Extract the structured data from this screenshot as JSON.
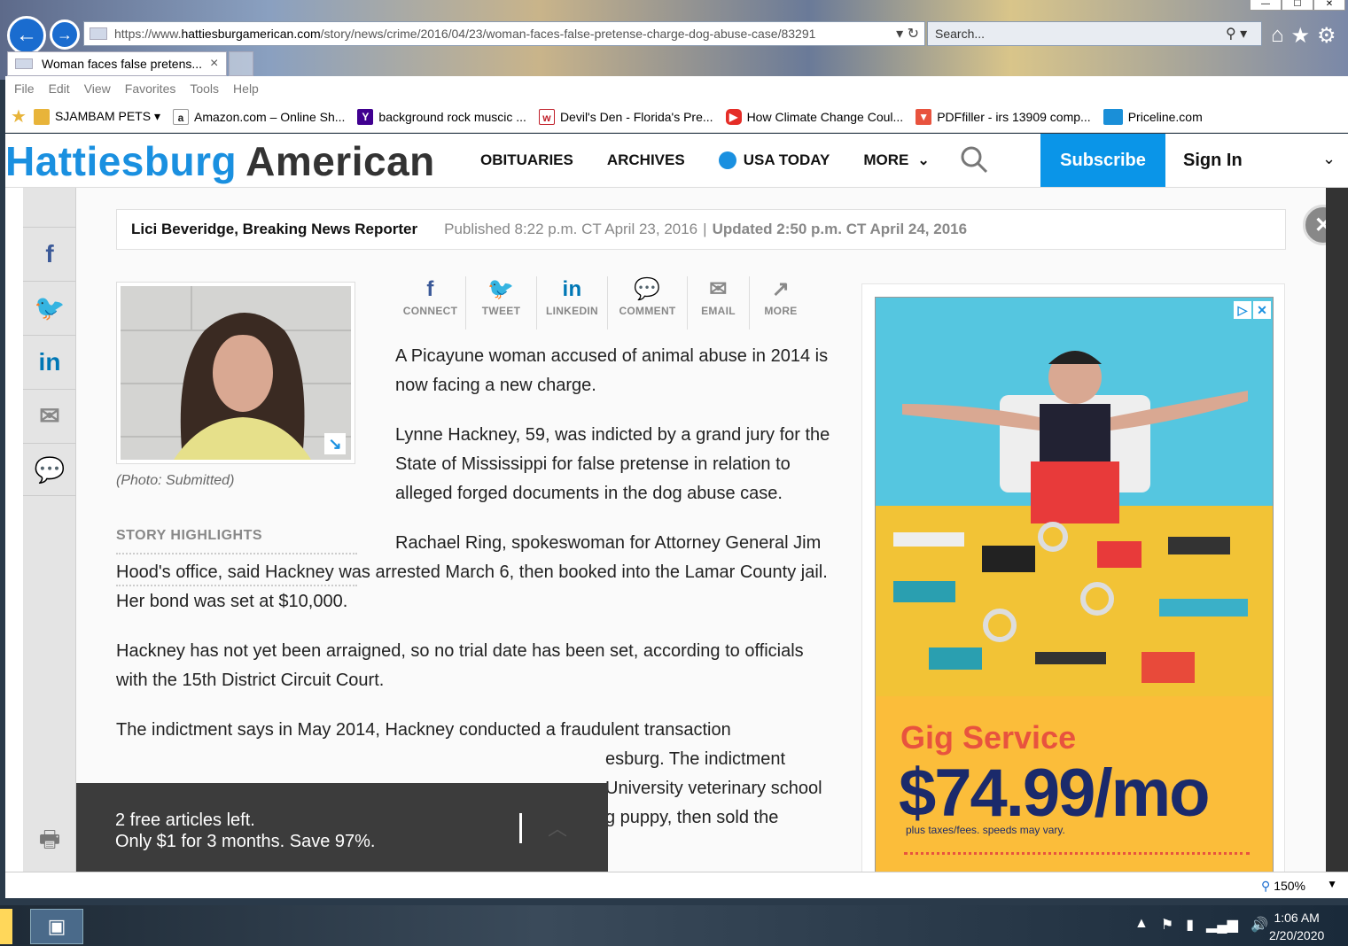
{
  "browser": {
    "url": "https://www.hattiesburgamerican.com/story/news/crime/2016/04/23/woman-faces-false-pretense-charge-dog-abuse-case/83291",
    "url_prefix": "https://www.",
    "url_domain": "hattiesburgamerican.com",
    "url_path": "/story/news/crime/2016/04/23/woman-faces-false-pretense-charge-dog-abuse-case/83291",
    "search_placeholder": "Search...",
    "tab_title": "Woman faces false pretens...",
    "tab_close": "×",
    "menu": [
      "File",
      "Edit",
      "View",
      "Favorites",
      "Tools",
      "Help"
    ],
    "favorites": [
      {
        "label": "SJAMBAM PETS ▾",
        "icon": "folder-icon",
        "color": "#e8b43a"
      },
      {
        "label": "Amazon.com – Online Sh...",
        "icon": "amazon-icon",
        "color": "#222222"
      },
      {
        "label": "background rock muscic ...",
        "icon": "yahoo-icon",
        "color": "#400090"
      },
      {
        "label": "Devil's Den - Florida's Pre...",
        "icon": "devils-den-icon",
        "color": "#c0202a"
      },
      {
        "label": "How Climate Change Coul...",
        "icon": "youtube-icon",
        "color": "#e52d27"
      },
      {
        "label": "PDFfiller - irs 13909 comp...",
        "icon": "pdffiller-icon",
        "color": "#e8533e"
      },
      {
        "label": "Priceline.com",
        "icon": "priceline-icon",
        "color": "#1a8fd8"
      }
    ],
    "zoom": "150%"
  },
  "site": {
    "logo_part1": "Hattiesburg",
    "logo_part2": "American",
    "nav": {
      "obituaries": "OBITUARIES",
      "archives": "ARCHIVES",
      "usa_today": "USA TODAY",
      "more": "MORE"
    },
    "subscribe": "Subscribe",
    "sign_in": "Sign In"
  },
  "article": {
    "author": "Lici Beveridge, Breaking News Reporter",
    "published": "Published 8:22 p.m. CT April 23, 2016",
    "separator": "|",
    "updated": "Updated 2:50 p.m. CT April 24, 2016",
    "photo_caption": "(Photo: Submitted)",
    "highlights_label": "STORY HIGHLIGHTS",
    "share": {
      "connect": "CONNECT",
      "tweet": "TWEET",
      "linkedin": "LINKEDIN",
      "comment": "COMMENT",
      "email": "EMAIL",
      "more": "MORE"
    },
    "p1": "A Picayune woman accused of animal abuse in 2014 is now facing a new charge.",
    "p2": "Lynne Hackney, 59, was indicted by a grand jury for the State of Mississippi for false pretense in relation to alleged forged documents in the dog abuse case.",
    "p3": "Rachael Ring, spokeswoman for Attorney General Jim Hood's office, said Hackney was arrested March 6, then booked into the Lamar County jail. Her bond was set at $10,000.",
    "p4": "Hackney has not yet been arraigned, so no trial date has been set, according to officials with the 15th District Circuit Court.",
    "p5": "The indictment says in May 2014, Hackney conducted a fraudulent transaction",
    "p5_tail1": "esburg. The indictment",
    "p5_tail2": "University veterinary school",
    "p5_tail3": "g puppy, then sold the"
  },
  "paywall": {
    "line1": "2 free articles left.",
    "line2": "Only $1 for 3 months. Save 97%."
  },
  "ad": {
    "headline": "Gig Service",
    "price": "$74.99/mo",
    "fine_print": "plus taxes/fees. speeds may vary."
  },
  "taskbar": {
    "time": "1:06 AM",
    "date": "2/20/2020"
  }
}
